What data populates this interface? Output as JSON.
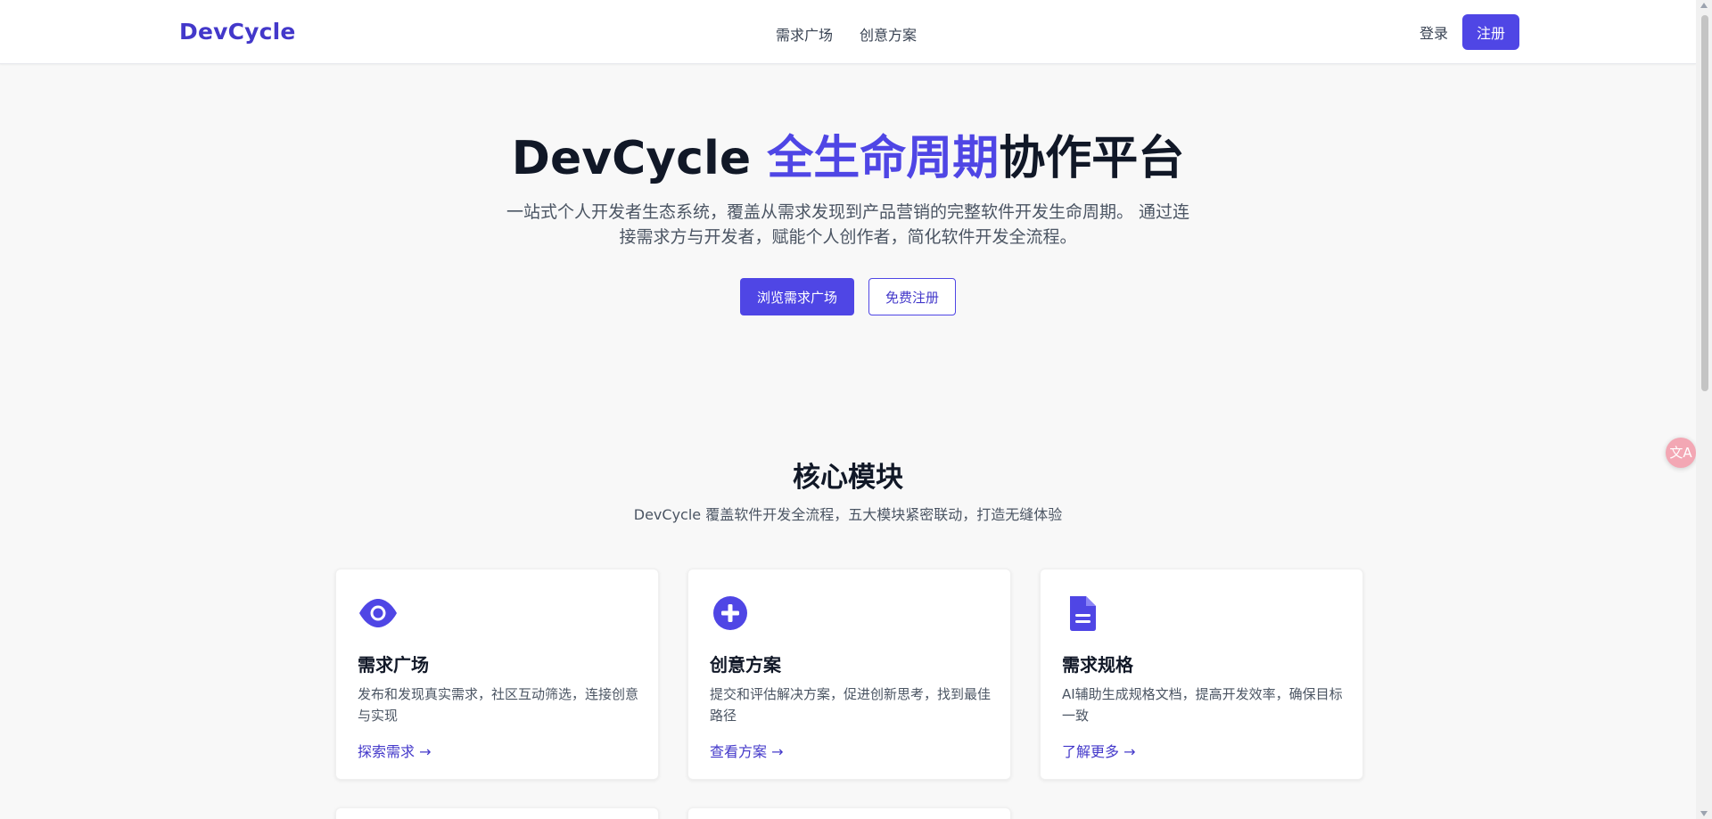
{
  "header": {
    "logo": "DevCycle",
    "nav": [
      {
        "label": "需求广场"
      },
      {
        "label": "创意方案"
      }
    ],
    "login_label": "登录",
    "register_label": "注册"
  },
  "hero": {
    "title_prefix": "DevCycle ",
    "title_accent": "全生命周期",
    "title_suffix": "协作平台",
    "description": "一站式个人开发者生态系统，覆盖从需求发现到产品营销的完整软件开发生命周期。 通过连接需求方与开发者，赋能个人创作者，简化软件开发全流程。",
    "primary_action": "浏览需求广场",
    "secondary_action": "免费注册"
  },
  "modules": {
    "title": "核心模块",
    "subtitle": "DevCycle 覆盖软件开发全流程，五大模块紧密联动，打造无缝体验",
    "cards": [
      {
        "icon": "eye-icon",
        "title": "需求广场",
        "description": "发布和发现真实需求，社区互动筛选，连接创意与实现",
        "link": "探索需求 →"
      },
      {
        "icon": "plus-circle-icon",
        "title": "创意方案",
        "description": "提交和评估解决方案，促进创新思考，找到最佳路径",
        "link": "查看方案 →"
      },
      {
        "icon": "document-icon",
        "title": "需求规格",
        "description": "AI辅助生成规格文档，提高开发效率，确保目标一致",
        "link": "了解更多 →"
      }
    ]
  },
  "floating": {
    "translate_icon": "translate-icon",
    "translate_glyph": "文A"
  },
  "colors": {
    "primary": "#4f46e5",
    "accent_text": "#4338ca",
    "background": "#f8f8f8"
  }
}
